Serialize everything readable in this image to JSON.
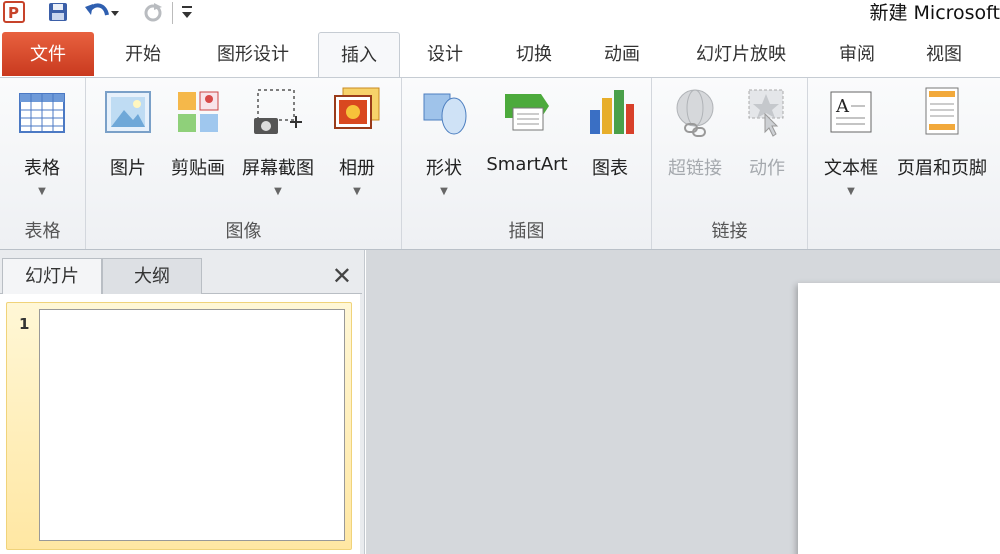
{
  "window": {
    "title": "新建 Microsoft"
  },
  "quick_access": {
    "icons": [
      "powerpoint-logo-icon",
      "save-icon",
      "undo-icon",
      "redo-icon",
      "customize-icon"
    ]
  },
  "tabs": [
    {
      "label": "文件"
    },
    {
      "label": "开始"
    },
    {
      "label": "图形设计"
    },
    {
      "label": "插入"
    },
    {
      "label": "设计"
    },
    {
      "label": "切换"
    },
    {
      "label": "动画"
    },
    {
      "label": "幻灯片放映"
    },
    {
      "label": "审阅"
    },
    {
      "label": "视图"
    }
  ],
  "active_tab": "插入",
  "ribbon": {
    "groups": [
      {
        "label": "表格",
        "buttons": [
          {
            "label": "表格",
            "icon": "table-icon"
          }
        ]
      },
      {
        "label": "图像",
        "buttons": [
          {
            "label": "图片",
            "icon": "picture-icon"
          },
          {
            "label": "剪贴画",
            "icon": "clipart-icon"
          },
          {
            "label": "屏幕截图",
            "icon": "screenshot-icon"
          },
          {
            "label": "相册",
            "icon": "photo-album-icon"
          }
        ]
      },
      {
        "label": "插图",
        "buttons": [
          {
            "label": "形状",
            "icon": "shapes-icon"
          },
          {
            "label": "SmartArt",
            "icon": "smartart-icon"
          },
          {
            "label": "图表",
            "icon": "chart-icon"
          }
        ]
      },
      {
        "label": "链接",
        "buttons": [
          {
            "label": "超链接",
            "icon": "hyperlink-icon"
          },
          {
            "label": "动作",
            "icon": "action-icon"
          }
        ]
      },
      {
        "label": "",
        "buttons": [
          {
            "label": "文本框",
            "icon": "textbox-icon"
          },
          {
            "label": "页眉和页脚",
            "icon": "header-footer-icon"
          }
        ]
      }
    ]
  },
  "slides_panel": {
    "tabs": [
      {
        "label": "幻灯片"
      },
      {
        "label": "大纲"
      }
    ],
    "close_glyph": "✕",
    "slides": [
      {
        "number": "1"
      }
    ]
  },
  "colors": {
    "file_tab": "#d9452b",
    "ribbon_bg": "#eef0f3",
    "selected_slide": "#ffe7a3",
    "editor_bg": "#d5d8dc"
  }
}
